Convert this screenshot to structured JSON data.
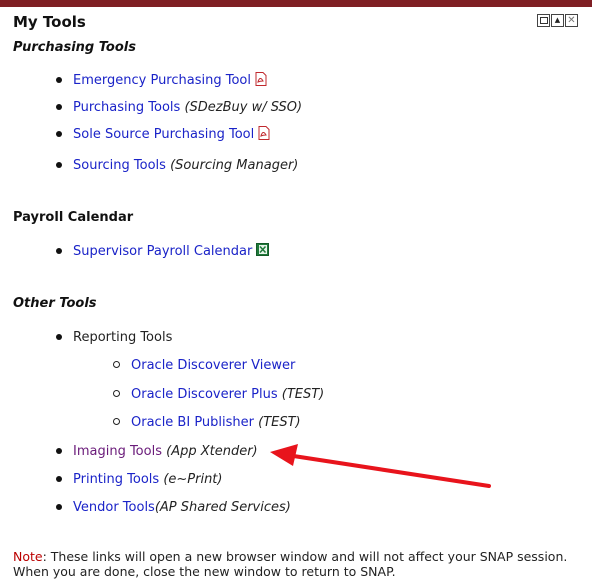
{
  "panel": {
    "title": "My Tools",
    "accent_color": "#7f1f24",
    "window_controls": [
      "maximize-icon",
      "move-up-icon",
      "close-icon"
    ]
  },
  "sections": {
    "purchasing": {
      "heading": "Purchasing Tools",
      "items": [
        {
          "label": "Emergency Purchasing Tool",
          "note": "",
          "icon": "pdf-icon"
        },
        {
          "label": "Purchasing Tools",
          "note": "(SDezBuy w/ SSO)",
          "icon": ""
        },
        {
          "label": "Sole Source Purchasing Tool",
          "note": "",
          "icon": "pdf-icon"
        },
        {
          "label": "Sourcing Tools",
          "note": "(Sourcing Manager)",
          "icon": ""
        }
      ]
    },
    "payroll": {
      "heading": "Payroll Calendar",
      "items": [
        {
          "label": "Supervisor Payroll Calendar",
          "note": "",
          "icon": "excel-icon"
        }
      ]
    },
    "other": {
      "heading": "Other Tools",
      "reporting_label": "Reporting Tools",
      "reporting_sub": [
        {
          "label": "Oracle Discoverer Viewer",
          "note": ""
        },
        {
          "label": "Oracle Discoverer Plus",
          "note": "(TEST)"
        },
        {
          "label": "Oracle BI Publisher",
          "note": "(TEST)"
        }
      ],
      "items": [
        {
          "label": "Imaging Tools",
          "note": "(App Xtender)"
        },
        {
          "label": "Printing Tools",
          "note": "(e~Print)"
        },
        {
          "label": "Vendor Tools",
          "note": "(AP Shared Services)"
        }
      ]
    }
  },
  "footer": {
    "note_label": "Note",
    "note_text": ": These links will open a new browser window and will not affect your SNAP session. When you are done, close the new window to return to SNAP."
  },
  "colors": {
    "link": "#1a23c8",
    "visited_link": "#6a1b7a",
    "annotation_arrow": "#e8141c",
    "note_label": "#bb0000"
  }
}
